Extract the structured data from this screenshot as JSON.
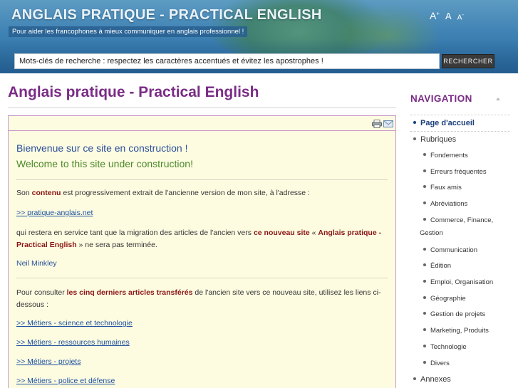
{
  "header": {
    "site_title": "ANGLAIS PRATIQUE - PRACTICAL ENGLISH",
    "tagline": "Pour aider les francophones à mieux communiquer en anglais professionnel !",
    "font_increase": "A",
    "font_default": "A",
    "font_decrease": "A",
    "font_plus": "+",
    "font_minus": "-"
  },
  "search": {
    "value": "Mots-clés de recherche : respectez les caractères accentués et évitez les apostrophes !",
    "button_label": "RECHERCHER"
  },
  "main": {
    "page_title": "Anglais pratique - Practical English",
    "welcome_fr": "Bienvenue sur ce site en construction !",
    "welcome_en": "Welcome to this site under construction!",
    "p1_pre": "Son ",
    "p1_bold": "contenu",
    "p1_post": " est progressivement extrait de l'ancienne version de mon site, à l'adresse :",
    "old_site_link": ">> pratique-anglais.net",
    "p2_pre": "qui restera en service tant que la migration des articles de l'ancien vers ",
    "p2_bold1": "ce nouveau site",
    "p2_mid": " « ",
    "p2_bold2": "Anglais pratique - Practical English",
    "p2_post": " » ne sera pas terminée.",
    "author": "Neil Minkley",
    "p3_pre": "Pour consulter ",
    "p3_bold": "les cinq derniers articles transférés",
    "p3_post": " de l'ancien site vers ce nouveau site, utilisez les liens ci-dessous :",
    "links": [
      ">> Métiers - science et technologie",
      ">> Métiers - ressources humaines",
      ">> Métiers - projets",
      ">> Métiers - police et défense"
    ]
  },
  "navigation": {
    "title": "NAVIGATION",
    "items": [
      {
        "label": "Page d'accueil"
      },
      {
        "label": "Rubriques"
      },
      {
        "label": "Fondements"
      },
      {
        "label": "Erreurs fréquentes"
      },
      {
        "label": "Faux amis"
      },
      {
        "label": "Abréviations"
      },
      {
        "label": "Commerce, Finance,"
      },
      {
        "label": "Gestion"
      },
      {
        "label": "Communication"
      },
      {
        "label": "Édition"
      },
      {
        "label": "Emploi, Organisation"
      },
      {
        "label": "Géographie"
      },
      {
        "label": "Gestion de projets"
      },
      {
        "label": "Marketing, Produits"
      },
      {
        "label": "Technologie"
      },
      {
        "label": "Divers"
      },
      {
        "label": "Annexes"
      }
    ]
  },
  "colors": {
    "accent_purple": "#7a2c86",
    "article_bg": "#fdfce1",
    "link_blue": "#1c4fa0",
    "bold_red": "#8a1515",
    "header_blue": "#3f82b4"
  },
  "icons": {
    "print": "print-icon",
    "email": "email-icon",
    "collapse": "chevron-up-icon"
  }
}
